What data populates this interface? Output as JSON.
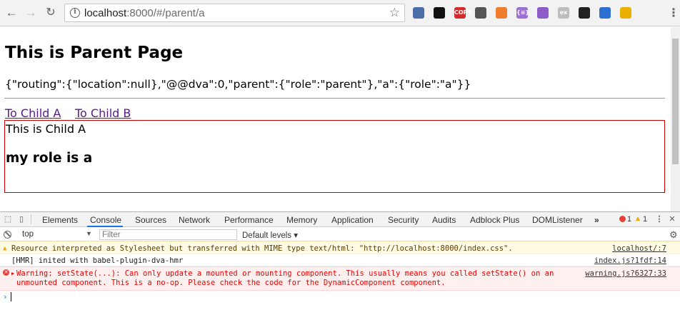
{
  "browser": {
    "url_host": "localhost",
    "url_path": ":8000/#/parent/a",
    "extensions": [
      {
        "icon": "eyedropper-icon",
        "label": "",
        "color": "#4a6ea8"
      },
      {
        "icon": "square-stop-icon",
        "label": "",
        "color": "#111111"
      },
      {
        "icon": "cors-icon",
        "label": "CORS",
        "color": "#d32b2b"
      },
      {
        "icon": "bulb-icon",
        "label": "",
        "color": "#555555"
      },
      {
        "icon": "bug-icon",
        "label": "",
        "color": "#f07d2c"
      },
      {
        "icon": "braces-icon",
        "label": "{≡}",
        "color": "#9b6fd3"
      },
      {
        "icon": "cursor-icon",
        "label": "",
        "color": "#8e5cc9"
      },
      {
        "icon": "ex-icon",
        "label": "ex",
        "color": "#bdbdbd"
      },
      {
        "icon": "gamepad-icon",
        "label": "",
        "color": "#222222"
      },
      {
        "icon": "disc-icon",
        "label": "",
        "color": "#2c6fd1"
      },
      {
        "icon": "compass-icon",
        "label": "",
        "color": "#e9b000"
      }
    ]
  },
  "page": {
    "title": "This is Parent Page",
    "state_json": "{\"routing\":{\"location\":null},\"@@dva\":0,\"parent\":{\"role\":\"parent\"},\"a\":{\"role\":\"a\"}}",
    "links": [
      "To Child A",
      "To Child B"
    ],
    "child_text": "This is Child A",
    "child_role": "my role is a"
  },
  "devtools": {
    "tabs": [
      "Elements",
      "Console",
      "Sources",
      "Network",
      "Performance",
      "Memory",
      "Application",
      "Security",
      "Audits",
      "Adblock Plus",
      "DOMListener"
    ],
    "active_tab": "Console",
    "more": "»",
    "error_count": "1",
    "warning_count": "1",
    "context": "top",
    "filter_placeholder": "Filter",
    "levels": "Default levels ▾",
    "logs": {
      "warn_text": "Resource interpreted as Stylesheet but transferred with MIME type text/html: \"http://localhost:8000/index.css\".",
      "warn_src": "localhost/:7",
      "info_text": "[HMR] inited with babel-plugin-dva-hmr",
      "info_src": "index.js?1fdf:14",
      "err_text": "Warning: setState(...): Can only update a mounted or mounting component. This usually means you called setState() on an\nunmounted component. This is a no-op. Please check the code for the DynamicComponent component.",
      "err_src": "warning.js?6327:33"
    },
    "prompt": "›"
  },
  "colors": {
    "link_visited": "#551a8b",
    "child_border": "#cc0000",
    "error_red": "#e00000",
    "warn_bg": "#fffbe5",
    "error_bg": "#fff0f0"
  }
}
